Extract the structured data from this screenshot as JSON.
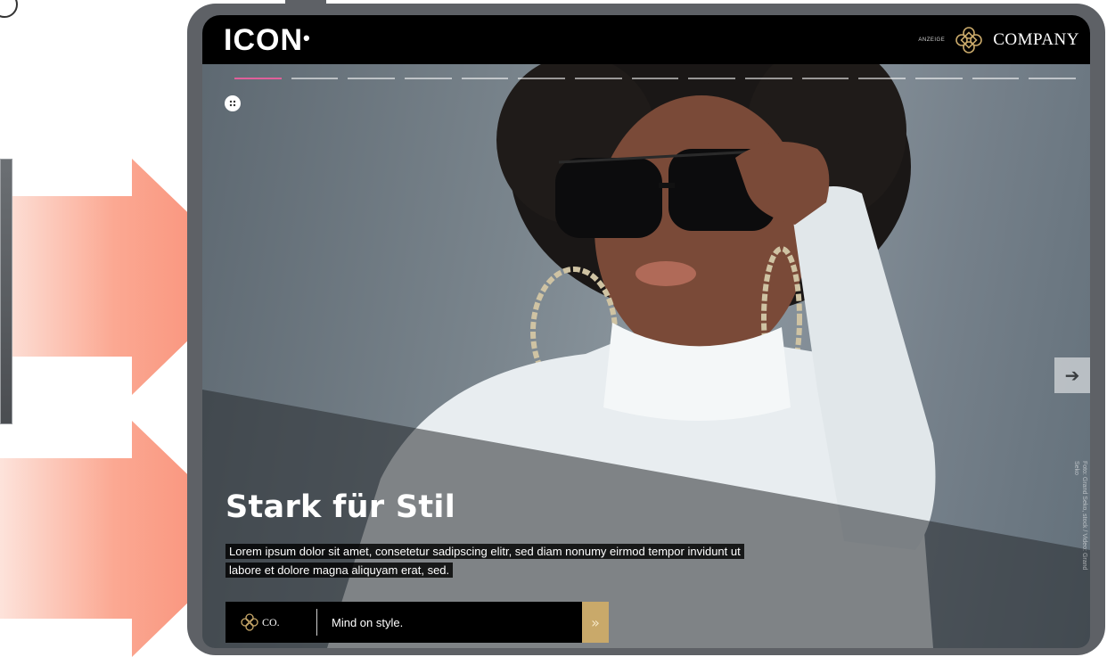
{
  "header": {
    "brand": "ICON",
    "brand_dot": "•",
    "ad_label": "ANZEIGE",
    "company": "COMPANY"
  },
  "slider": {
    "segments": 15,
    "active_segment": 1
  },
  "hero": {
    "headline": "Stark für Stil",
    "teaser": "Lorem ipsum dolor sit amet, consetetur sadipscing elitr, sed diam nonumy eirmod tempor invidunt ut labore et dolore magna aliquyam erat, sed.",
    "credit": "Foto: Grand Seko, stock / Video: Grand Seko"
  },
  "cta": {
    "logo_text": "CO.",
    "text": "Mind on style.",
    "arrow": "»"
  },
  "icons": {
    "menu": "grid-dots-icon",
    "next": "arrow-right-icon",
    "company": "knot-logo-icon"
  },
  "colors": {
    "accent": "#e0609a",
    "gold": "#c9a96a",
    "arrow": "#f98a72",
    "device": "#5e6166",
    "bar": "#000000"
  }
}
